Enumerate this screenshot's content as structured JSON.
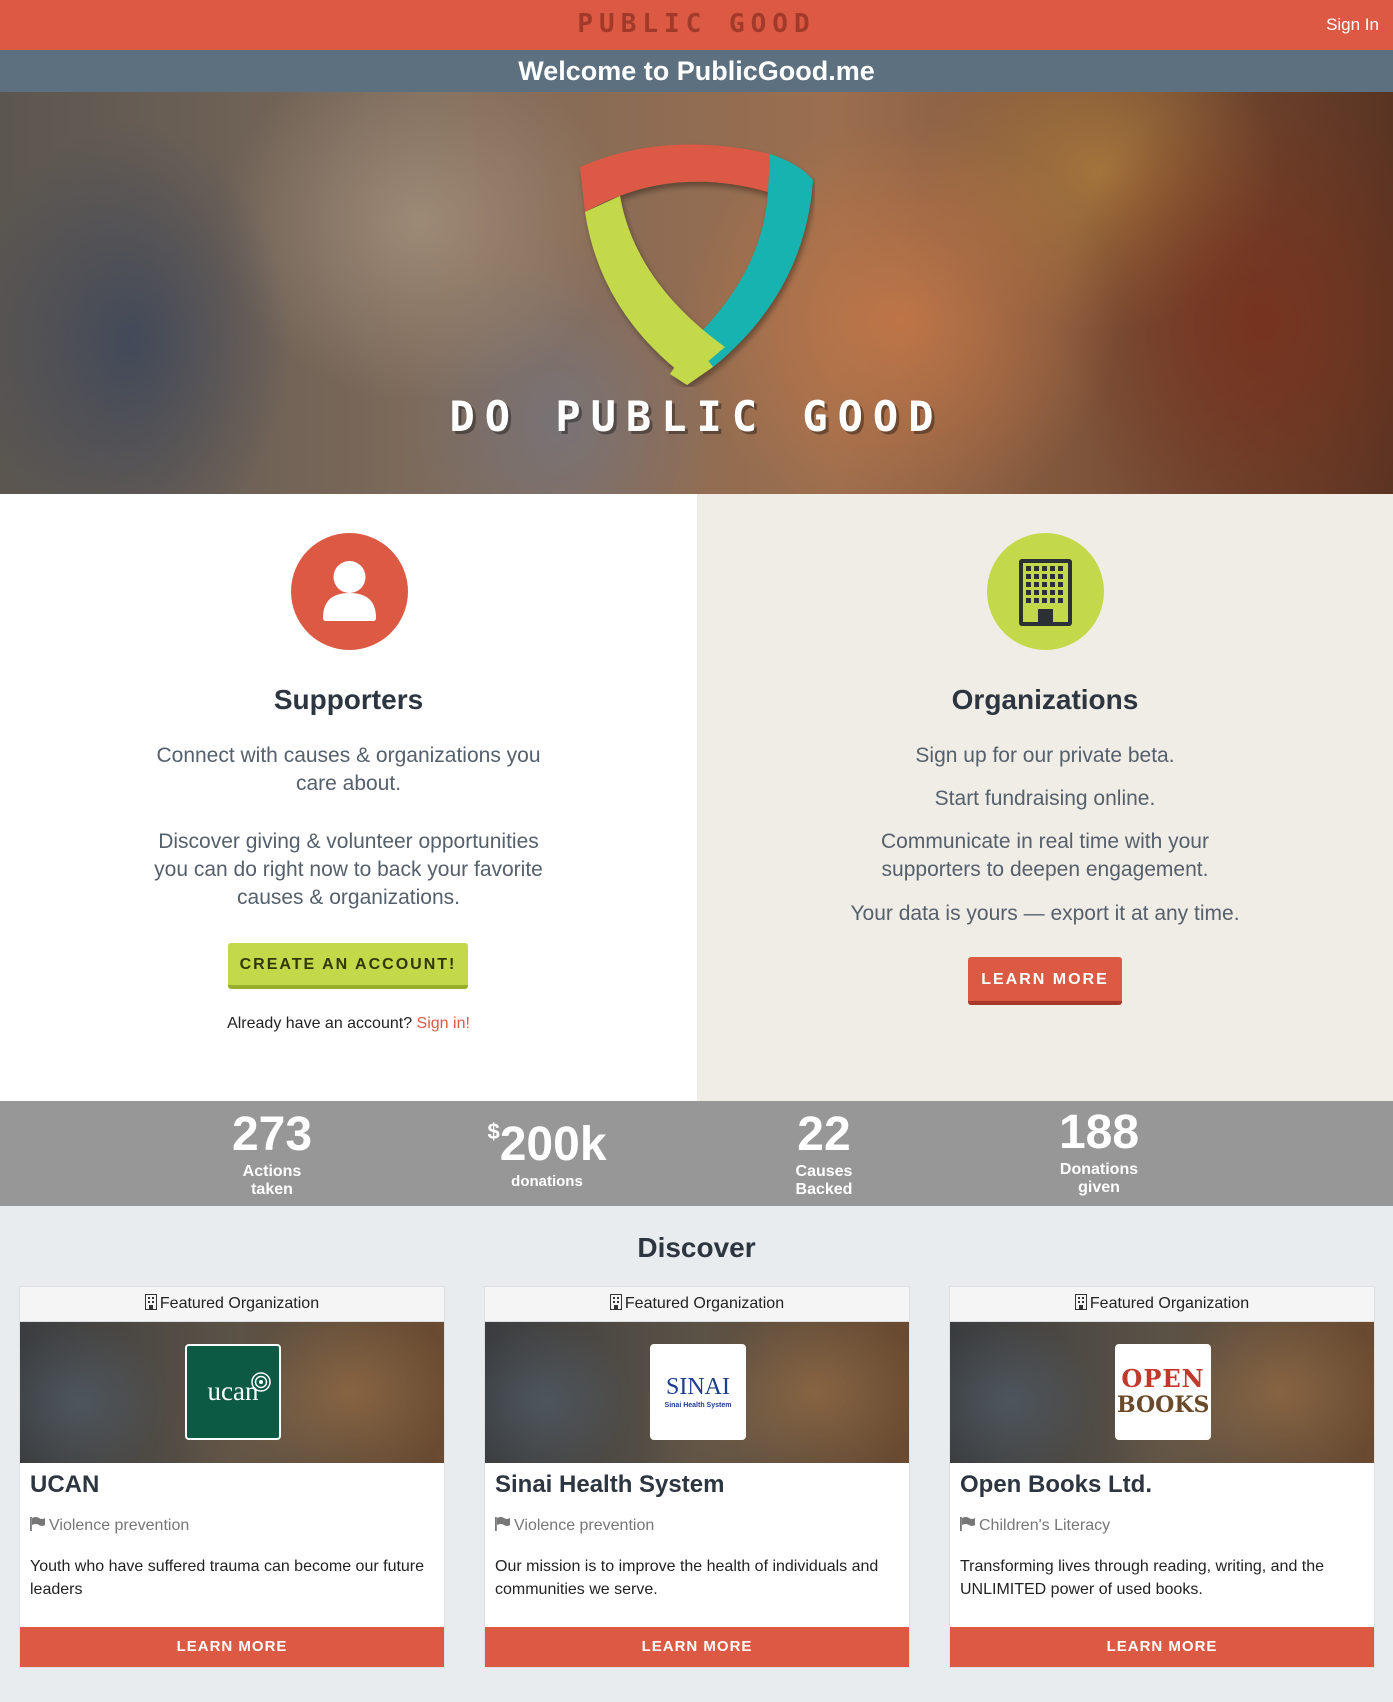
{
  "header": {
    "brand": "PUBLIC GOOD",
    "sign_in": "Sign In"
  },
  "welcome": {
    "text": "Welcome to PublicGood.me"
  },
  "hero": {
    "title": "DO PUBLIC GOOD"
  },
  "supporters": {
    "title": "Supporters",
    "paragraph1": "Connect with causes & organizations you care about.",
    "paragraph2": "Discover giving & volunteer opportunities you can do right now to back your favorite causes & organizations.",
    "button": "CREATE AN ACCOUNT!",
    "already_text": "Already have an account?",
    "sign_in_link": "Sign in!"
  },
  "organizations": {
    "title": "Organizations",
    "line1": "Sign up for our private beta.",
    "line2": "Start fundraising online.",
    "line3": "Communicate in real time with your supporters to deepen engagement.",
    "line4": "Your data is yours — export it at any time.",
    "button": "LEARN MORE"
  },
  "stats": [
    {
      "number": "273",
      "label": "Actions taken"
    },
    {
      "prefix": "$",
      "number": "200k",
      "label": "donations"
    },
    {
      "number": "22",
      "label": "Causes Backed"
    },
    {
      "number": "188",
      "label": "Donations given"
    }
  ],
  "discover": {
    "title": "Discover",
    "cards": [
      {
        "header": "Featured Organization",
        "logo_text": "ucan",
        "name": "UCAN",
        "category": "Violence prevention",
        "description": "Youth who have suffered trauma can become our future leaders",
        "button": "LEARN MORE"
      },
      {
        "header": "Featured Organization",
        "logo_text": "SINAI",
        "logo_subtext": "Sinai Health System",
        "name": "Sinai Health System",
        "category": "Violence prevention",
        "description": "Our mission is to improve the health of individuals and communities we serve.",
        "button": "LEARN MORE"
      },
      {
        "header": "Featured Organization",
        "logo_text": "OPEN",
        "logo_subtext": "BOOKS",
        "name": "Open Books Ltd.",
        "category": "Children's Literacy",
        "description": "Transforming lives through reading, writing, and the UNLIMITED power of used books.",
        "button": "LEARN MORE"
      }
    ]
  },
  "colors": {
    "brand_red": "#dc5a44",
    "accent_green": "#c3d94a",
    "accent_teal": "#12b3b0",
    "slate": "#5c7080"
  }
}
